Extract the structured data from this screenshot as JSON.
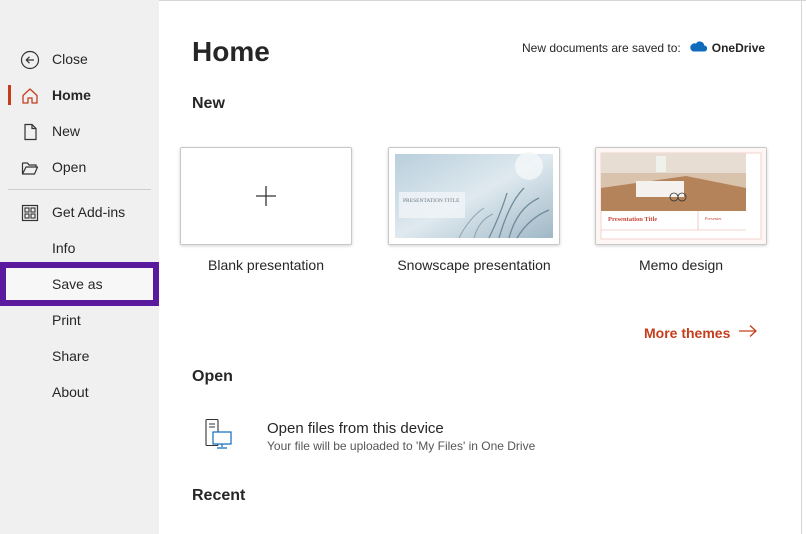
{
  "sidebar": {
    "items": [
      {
        "id": "close",
        "label": "Close",
        "icon": "back-arrow-icon"
      },
      {
        "id": "home",
        "label": "Home",
        "icon": "home-icon"
      },
      {
        "id": "new",
        "label": "New",
        "icon": "new-document-icon"
      },
      {
        "id": "open",
        "label": "Open",
        "icon": "folder-open-icon"
      },
      {
        "id": "addins",
        "label": "Get Add-ins",
        "icon": "add-ins-grid-icon"
      },
      {
        "id": "info",
        "label": "Info"
      },
      {
        "id": "saveas",
        "label": "Save as"
      },
      {
        "id": "print",
        "label": "Print"
      },
      {
        "id": "share",
        "label": "Share"
      },
      {
        "id": "about",
        "label": "About"
      }
    ],
    "active": "home",
    "highlight_color": "#5a1a9e",
    "accent_color": "#c43e1c"
  },
  "main": {
    "title": "Home",
    "saved_to_label": "New documents are saved to:",
    "saved_to_location": "OneDrive",
    "new_section": "New",
    "templates": [
      {
        "name": "Blank presentation",
        "thumb_text": "+"
      },
      {
        "name": "Snowscape presentation",
        "thumb_title": "PRESENTATION TITLE"
      },
      {
        "name": "Memo design",
        "thumb_title": "Presentation Title",
        "thumb_sub": "Presenter"
      }
    ],
    "more_themes": "More themes",
    "open_section": "Open",
    "open_device_title": "Open files from this device",
    "open_device_subtitle": "Your file will be uploaded to 'My Files' in One Drive",
    "recent_section": "Recent"
  }
}
